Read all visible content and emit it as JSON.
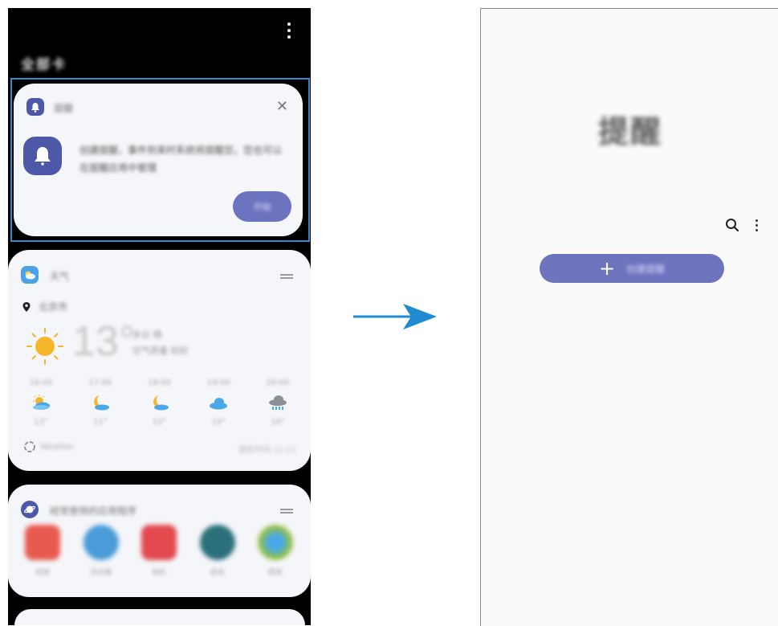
{
  "left_screen": {
    "page_title": "全部卡",
    "notification_card": {
      "app_name": "提醒",
      "message": "创建提醒，事件到来时系统将提醒您，您也可以在提醒应用中管理",
      "action_label": "开始",
      "close_glyph": "✕"
    },
    "weather_card": {
      "app_name": "天气",
      "location": "北京市",
      "temperature": "13°",
      "details": [
        "多云 晴",
        "空气质量 较好"
      ],
      "forecast": [
        {
          "time": "16:00",
          "icon": "partly-cloudy-icon",
          "temp": "13°"
        },
        {
          "time": "17:00",
          "icon": "moon-cloud-icon",
          "temp": "11°"
        },
        {
          "time": "18:00",
          "icon": "moon-cloud-icon",
          "temp": "10°"
        },
        {
          "time": "19:00",
          "icon": "cloud-icon",
          "temp": "10°"
        },
        {
          "time": "20:00",
          "icon": "rain-cloud-icon",
          "temp": "10°"
        }
      ],
      "provider": "Weather",
      "updated": "更新时间 11:21"
    },
    "apps_card": {
      "title": "经常使用的应用程序",
      "apps": [
        {
          "label": "视频",
          "color": "#e85a50"
        },
        {
          "label": "浏览器",
          "color": "#4a9bd8"
        },
        {
          "label": "相机",
          "color": "#e24a50"
        },
        {
          "label": "游戏",
          "color": "#2b6f7a"
        },
        {
          "label": "图库",
          "color": "#8cc04a"
        }
      ]
    }
  },
  "right_screen": {
    "title": "提醒",
    "add_button_label": "创建提醒"
  },
  "colors": {
    "accent": "#4d59a8",
    "button": "#6e73bd",
    "arrow": "#1f8bd0",
    "highlight_border": "#2f8ccd"
  }
}
